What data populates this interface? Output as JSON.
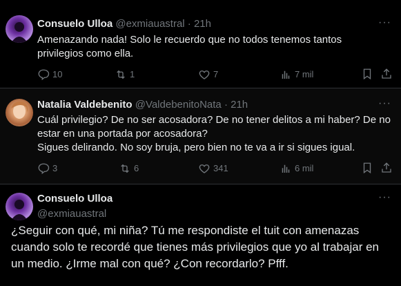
{
  "tweets": [
    {
      "name": "Consuelo Ulloa",
      "handle": "@exmiauastral",
      "time": "21h",
      "text": "Amenazando nada! Solo le recuerdo que no todos tenemos tantos privilegios como ella.",
      "replies": "10",
      "retweets": "1",
      "likes": "7",
      "views": "7 mil"
    },
    {
      "name": "Natalia Valdebenito",
      "handle": "@ValdebenitoNata",
      "time": "21h",
      "text": "Cuál privilegio? De no ser acosadora? De no tener delitos a mi haber? De no estar en una portada por acosadora?",
      "text2": "Sigues delirando. No soy bruja, pero bien no te va a ir si sigues igual.",
      "replies": "3",
      "retweets": "6",
      "likes": "341",
      "views": "6 mil"
    },
    {
      "name": "Consuelo Ulloa",
      "handle": "@exmiauastral",
      "text": "¿Seguir con qué, mi niña? Tú me respondiste el tuit con amenazas cuando solo te recordé que tienes más privilegios que yo al trabajar en un medio. ¿Irme mal con qué? ¿Con recordarlo? Pfff."
    }
  ],
  "separator": "·",
  "more_label": "···"
}
